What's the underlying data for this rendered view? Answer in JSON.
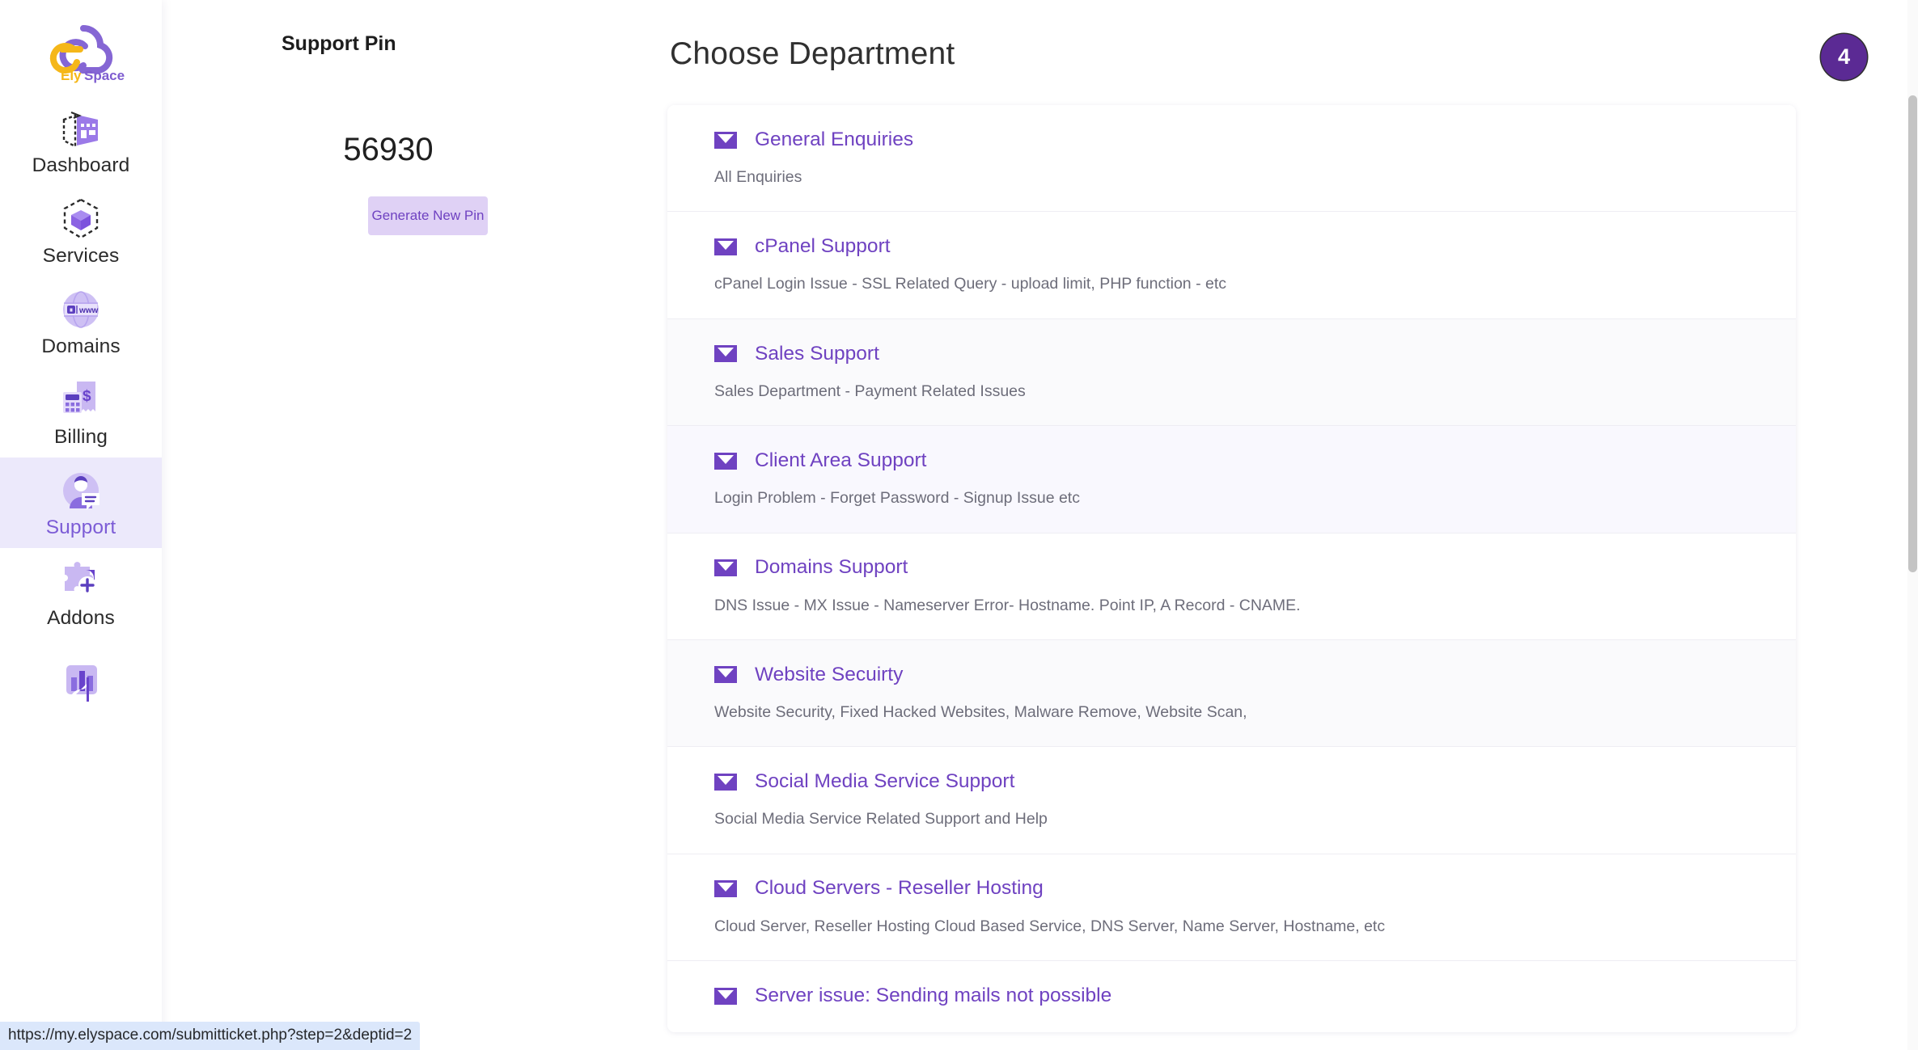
{
  "sidebar": {
    "logo": {
      "brand_first": "Ely",
      "brand_second": "Space",
      "icon": "cloud-e-logo"
    },
    "items": [
      {
        "label": "Dashboard",
        "icon": "dashboard-icon",
        "active": false
      },
      {
        "label": "Services",
        "icon": "services-cube-icon",
        "active": false
      },
      {
        "label": "Domains",
        "icon": "domains-globe-www-icon",
        "active": false
      },
      {
        "label": "Billing",
        "icon": "billing-calculator-invoice-icon",
        "active": false
      },
      {
        "label": "Support",
        "icon": "support-agent-chat-icon",
        "active": true
      },
      {
        "label": "Addons",
        "icon": "addons-puzzle-plus-icon",
        "active": false
      },
      {
        "label": "",
        "icon": "affiliates-chart-icon",
        "active": false
      }
    ]
  },
  "support_pin": {
    "title": "Support Pin",
    "value": "56930",
    "generate_button": "Generate New Pin"
  },
  "main": {
    "title": "Choose Department",
    "badge": "4"
  },
  "departments": [
    {
      "name": "General Enquiries",
      "description": "All Enquiries",
      "icon": "envelope-icon"
    },
    {
      "name": "cPanel Support",
      "description": "cPanel Login Issue - SSL Related Query - upload limit, PHP function - etc",
      "icon": "envelope-icon"
    },
    {
      "name": "Sales Support",
      "description": "Sales Department - Payment Related Issues",
      "icon": "envelope-icon"
    },
    {
      "name": "Client Area Support",
      "description": "Login Problem - Forget Password - Signup Issue etc",
      "icon": "envelope-icon"
    },
    {
      "name": "Domains Support",
      "description": "DNS Issue - MX Issue - Nameserver Error- Hostname. Point IP, A Record - CNAME.",
      "icon": "envelope-icon"
    },
    {
      "name": "Website Secuirty",
      "description": "Website Security, Fixed Hacked Websites, Malware Remove, Website Scan,",
      "icon": "envelope-icon"
    },
    {
      "name": "Social Media Service Support",
      "description": "Social Media Service Related Support and Help",
      "icon": "envelope-icon"
    },
    {
      "name": "Cloud Servers - Reseller Hosting",
      "description": "Cloud Server, Reseller Hosting Cloud Based Service, DNS Server, Name Server, Hostname, etc",
      "icon": "envelope-icon"
    },
    {
      "name": "Server issue: Sending mails not possible",
      "description": "",
      "icon": "envelope-icon"
    }
  ],
  "status_bar": {
    "url": "https://my.elyspace.com/submitticket.php?step=2&deptid=2"
  },
  "colors": {
    "accent_purple": "#6f42c1",
    "badge_purple": "#5b2a94",
    "active_nav_bg": "#ece9fb",
    "pin_button_bg": "#dfd1f5",
    "logo_yellow": "#f5b719"
  }
}
